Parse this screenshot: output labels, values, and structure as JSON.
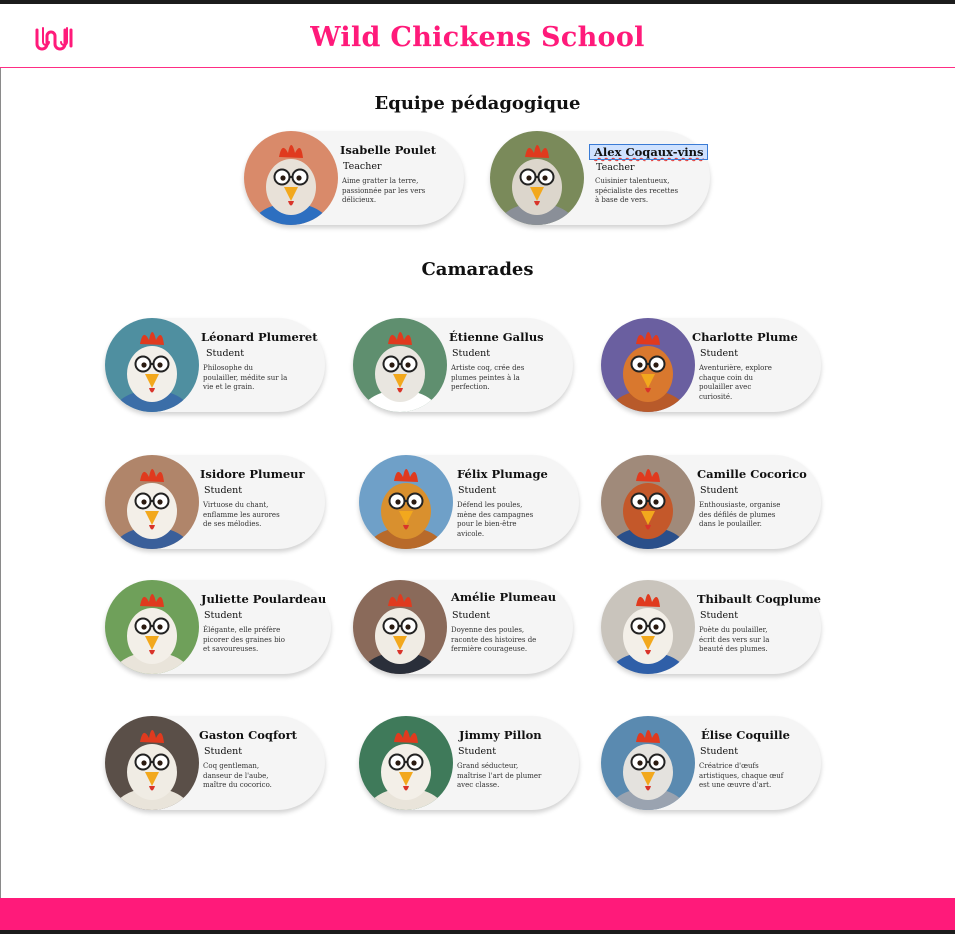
{
  "header": {
    "title": "Wild Chickens School",
    "logo_icon": "wave-w-logo-icon",
    "brand_color": "#ff1a7a"
  },
  "sections": {
    "teachers_title": "Equipe pédagogique",
    "students_title": "Camarades"
  },
  "teachers": [
    {
      "name": "Isabelle Poulet",
      "role": "Teacher",
      "desc": "Aime gratter la terre, passionnée par les vers délicieux.",
      "bg": "#d98a6a",
      "body": "#2d6fc0",
      "feather": "#e8e1d8"
    },
    {
      "name": "Alex Coqaux-vins",
      "role": "Teacher",
      "desc": "Cuisinier talentueux, spécialiste des recettes à base de vers.",
      "bg": "#7a8a5a",
      "body": "#8a8f98",
      "feather": "#dcd6cc"
    }
  ],
  "students": [
    {
      "name": "Léonard Plumeret",
      "role": "Student",
      "desc": "Philosophe du poulailler, médite sur la vie et le grain.",
      "bg": "#4f8fa0",
      "body": "#3b6ea8",
      "feather": "#f2efe9"
    },
    {
      "name": "Étienne Gallus",
      "role": "Student",
      "desc": "Artiste coq, crée des plumes peintes à la perfection.",
      "bg": "#5f8f6f",
      "body": "#ffffff",
      "feather": "#e9e6e0"
    },
    {
      "name": "Charlotte Plume",
      "role": "Student",
      "desc": "Aventurière, explore chaque coin du poulailler avec curiosité.",
      "bg": "#6a5fa0",
      "body": "#b85a2a",
      "feather": "#d9782e"
    },
    {
      "name": "Isidore Plumeur",
      "role": "Student",
      "desc": "Virtuose du chant, enflamme les aurores de ses mélodies.",
      "bg": "#b0856a",
      "body": "#3a5f9a",
      "feather": "#f3efe8"
    },
    {
      "name": "Félix Plumage",
      "role": "Student",
      "desc": "Défend les poules, mène des campagnes pour le bien-être avicole.",
      "bg": "#6fa0c8",
      "body": "#b86a2a",
      "feather": "#d9902e"
    },
    {
      "name": "Camille Cocorico",
      "role": "Student",
      "desc": "Enthousiaste, organise des défilés de plumes dans le poulailler.",
      "bg": "#a08a7a",
      "body": "#2a4f8a",
      "feather": "#c4582a"
    },
    {
      "name": "Juliette Poulardeau",
      "role": "Student",
      "desc": "Élégante, elle préfère picorer des graines bio et savoureuses.",
      "bg": "#6fa05a",
      "body": "#e9e4da",
      "feather": "#f3efe8"
    },
    {
      "name": "Amélie Plumeau",
      "role": "Student",
      "desc": "Doyenne des poules, raconte des histoires de fermière courageuse.",
      "bg": "#8a6a5a",
      "body": "#2a2f3a",
      "feather": "#f0ece4"
    },
    {
      "name": "Thibault Coqplume",
      "role": "Student",
      "desc": "Poète du poulailler, écrit des vers sur la beauté des plumes.",
      "bg": "#c9c4bc",
      "body": "#2f5fa8",
      "feather": "#f3efe8"
    },
    {
      "name": "Gaston Coqfort",
      "role": "Student",
      "desc": "Coq gentleman, danseur de l'aube, maître du cocorico.",
      "bg": "#5a4f48",
      "body": "#e9e4da",
      "feather": "#f0ece4"
    },
    {
      "name": "Jimmy Pillon",
      "role": "Student",
      "desc": "Grand séducteur, maîtrise l'art de plumer avec classe.",
      "bg": "#3f7a5a",
      "body": "#e9e4da",
      "feather": "#f3efe8"
    },
    {
      "name": "Élise Coquille",
      "role": "Student",
      "desc": "Créatrice d'œufs artistiques, chaque œuf est une œuvre d'art.",
      "bg": "#5a8ab0",
      "body": "#9aa3b0",
      "feather": "#e4e2de"
    }
  ]
}
